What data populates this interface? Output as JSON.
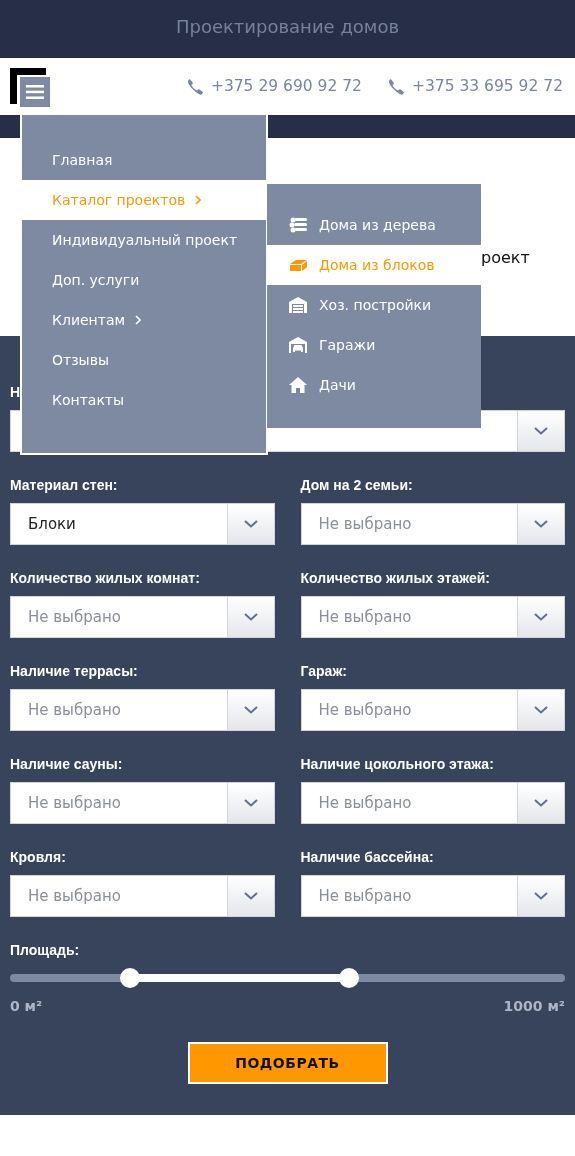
{
  "top_band": {
    "title": "Проектирование домов"
  },
  "header": {
    "phones": [
      "+375 29 690 92 72",
      "+375 33 695 92 72"
    ]
  },
  "content_fragment": "роект",
  "main_menu": [
    {
      "label": "Главная",
      "selected": false,
      "has_submenu": false
    },
    {
      "label": "Каталог проектов",
      "selected": true,
      "has_submenu": true
    },
    {
      "label": "Индивидуальный проект",
      "selected": false,
      "has_submenu": false
    },
    {
      "label": "Доп. услуги",
      "selected": false,
      "has_submenu": false
    },
    {
      "label": "Клиентам",
      "selected": false,
      "has_submenu": true
    },
    {
      "label": "Отзывы",
      "selected": false,
      "has_submenu": false
    },
    {
      "label": "Контакты",
      "selected": false,
      "has_submenu": false
    }
  ],
  "submenu": [
    {
      "label": "Дома из дерева",
      "kind": "logs",
      "selected": false
    },
    {
      "label": "Дома из блоков",
      "kind": "block",
      "selected": true
    },
    {
      "label": "Хоз. постройки",
      "kind": "warehouse",
      "selected": false
    },
    {
      "label": "Гаражи",
      "kind": "garage",
      "selected": false
    },
    {
      "label": "Дачи",
      "kind": "house",
      "selected": false
    }
  ],
  "filters": [
    {
      "kind": "wide",
      "label": "Н"
    },
    {
      "kind": "half",
      "label": "Материал стен:",
      "value": "Блоки"
    },
    {
      "kind": "half",
      "label": "Дом на 2 семьи:",
      "placeholder": "Не выбрано"
    },
    {
      "kind": "half",
      "label": "Количество жилых комнат:",
      "placeholder": "Не выбрано"
    },
    {
      "kind": "half",
      "label": "Количество жилых этажей:",
      "placeholder": "Не выбрано"
    },
    {
      "kind": "half",
      "label": "Наличие террасы:",
      "placeholder": "Не выбрано"
    },
    {
      "kind": "half",
      "label": "Гараж:",
      "placeholder": "Не выбрано"
    },
    {
      "kind": "half",
      "label": "Наличие сауны:",
      "placeholder": "Не выбрано"
    },
    {
      "kind": "half",
      "label": "Наличие цокольного этажа:",
      "placeholder": "Не выбрано"
    },
    {
      "kind": "half",
      "label": "Кровля:",
      "placeholder": "Не выбрано"
    },
    {
      "kind": "half",
      "label": "Наличие бассейна:",
      "placeholder": "Не выбрано"
    }
  ],
  "area": {
    "label": "Площадь:",
    "thumbs": [
      {
        "level": 0.216
      },
      {
        "level": 0.611
      }
    ],
    "min_label": "0 м²",
    "max_label": "1000 м²"
  },
  "submit": "ПОДОБРАТЬ"
}
